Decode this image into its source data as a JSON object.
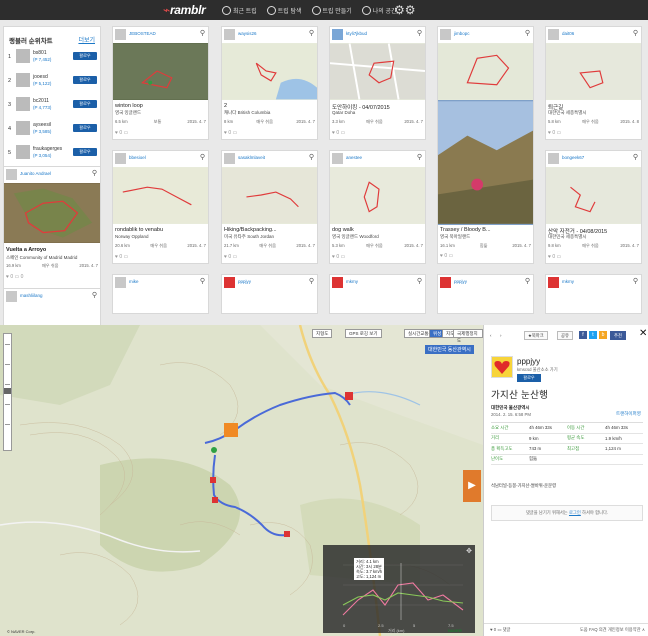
{
  "header": {
    "logo": "ramblr",
    "nav": [
      "최근 트립",
      "트립 탐색",
      "트립 만들기",
      "나의 공간"
    ],
    "settings_icon": "gear-icon"
  },
  "ranking": {
    "title": "랭블러 순위차트",
    "more": "더보기",
    "follow_label": "팔로우",
    "rows": [
      {
        "num": "1",
        "name": "bs801",
        "pts": "(P 7,452)"
      },
      {
        "num": "2",
        "name": "jooesd",
        "pts": "(P 5,122)"
      },
      {
        "num": "3",
        "name": "bc2011",
        "pts": "(P 4,773)"
      },
      {
        "num": "4",
        "name": "ayseesil",
        "pts": "(P 3,585)"
      },
      {
        "num": "5",
        "name": "fraukagerges",
        "pts": "(P 3,054)"
      }
    ]
  },
  "cards": [
    {
      "user": "Juanito Andrael",
      "title": "Vuelta a Arroyo",
      "loc": "스페인 Community of Madrid Madrid",
      "dist": "16.9 km",
      "diff": "매우 쉬움",
      "date": "2015. 4. 7",
      "foot": "♥ 0  ▭ 0"
    },
    {
      "user": "JEBOSTEAD",
      "title": "winton loop",
      "loc": "영국 잉글랜드",
      "dist": "6.5 km",
      "diff": "보통",
      "date": "2015. 4. 7",
      "foot": "♥ 0  ▭"
    },
    {
      "user": "waysis26",
      "title": "2",
      "loc": "캐나다 British Columbia",
      "dist": "8 km",
      "diff": "매우 쉬움",
      "date": "2015. 4. 7",
      "foot": "♥ 0  ▭"
    },
    {
      "user": "ktyli7jkbud",
      "title": "도안하이킹 - 04/07/2015",
      "loc": "Qatar Doha",
      "dist": "3.3 km",
      "diff": "매우 쉬움",
      "date": "2015. 4. 7",
      "foot": "♥ 0  ▭"
    },
    {
      "user": "jimbopc",
      "title": "Trassey / Bloody B...",
      "loc": "영국 북아일랜드",
      "dist": "16.1 km",
      "diff": "힘듦",
      "date": "2015. 4. 7",
      "foot": "♥ 0  ▭"
    },
    {
      "user": "dait06",
      "title": "퇴근길",
      "loc": "대한민국 세종특별시",
      "dist": "5.8 km",
      "diff": "매우 쉬움",
      "date": "2015. 4. 8",
      "foot": "♥ 0  ▭"
    },
    {
      "user": "bbesioel",
      "title": "rondablik to venabu",
      "loc": "Norway Oppland",
      "dist": "20.6 km",
      "diff": "매우 쉬움",
      "date": "2015. 4. 7",
      "foot": "♥ 0  ▭"
    },
    {
      "user": "sasaklmlaveit",
      "title": "Hiking/Backpacking...",
      "loc": "미국 유타주 South Jordan",
      "dist": "21.7 km",
      "diff": "매우 쉬움",
      "date": "2015. 4. 7",
      "foot": "♥ 0  ▭"
    },
    {
      "user": "anestee",
      "title": "dog walk",
      "loc": "영국 잉글랜드 Woodford",
      "dist": "5.3 km",
      "diff": "매우 쉬움",
      "date": "2015. 4. 7",
      "foot": "♥ 0  ▭"
    },
    {
      "user": "bongeek67",
      "title": "산악 자전거 - 04/08/2015",
      "loc": "대한민국 세종특별시",
      "dist": "9.8 km",
      "diff": "매우 쉬움",
      "date": "2015. 4. 7",
      "foot": "♥ 0  ▭"
    }
  ],
  "row3_users": [
    "mashliilang",
    "mike",
    "",
    "pppjyy",
    "mkmy",
    "pppjyy",
    "mkmy"
  ],
  "map": {
    "tools": [
      "지형도",
      "GPS 로깅 보기",
      "실시간교통",
      "위성",
      "지도",
      "국제행정지도"
    ],
    "region": "대한민국 동산관역시",
    "scale": "© NAVER Corp.",
    "brand": "NAVER",
    "elev_tip": [
      "거리: 4.1 km",
      "시간: 3시 28분",
      "속도: 3.7 km/h",
      "고도: 1,124 m"
    ],
    "elev_xlabel": "거리 (km)",
    "elev_ticks": [
      "0",
      "2.5",
      "5",
      "7.5"
    ]
  },
  "panel": {
    "nav_prev": "‹",
    "nav_next": "›",
    "bookmark": "북마크",
    "share": "공유",
    "recommend": "추천",
    "user": "pppjyy",
    "org": "kmscsd 울산소소 가기",
    "follow": "팔로우",
    "title": "가지산 눈산행",
    "place": "대한민국 울산광역시",
    "date": "2014. 2. 15. 6:58 PM",
    "download": "트랜하이퍼영",
    "stats": [
      [
        "소요 시간",
        "4h 46m 33s",
        "이동 시간",
        "4h 46m 33s"
      ],
      [
        "거리",
        "9 km",
        "평균 속도",
        "1.9 km/h"
      ],
      [
        "총 획득고도",
        "743 m",
        "최고점",
        "1,124 m"
      ],
      [
        "난이도",
        "힘듦",
        "",
        ""
      ]
    ],
    "path": "석남터널-등봉-가지산-쌀바위-운문령",
    "comment_pre": "댓글을 남기기 위해서는 ",
    "comment_link": "로그인",
    "comment_post": " 하셔야 합니다.",
    "foot_left": "♥ 0  ▭ 댓글",
    "foot_right": "도움 FAQ  의견  개인정보  이용약관  ∧"
  }
}
